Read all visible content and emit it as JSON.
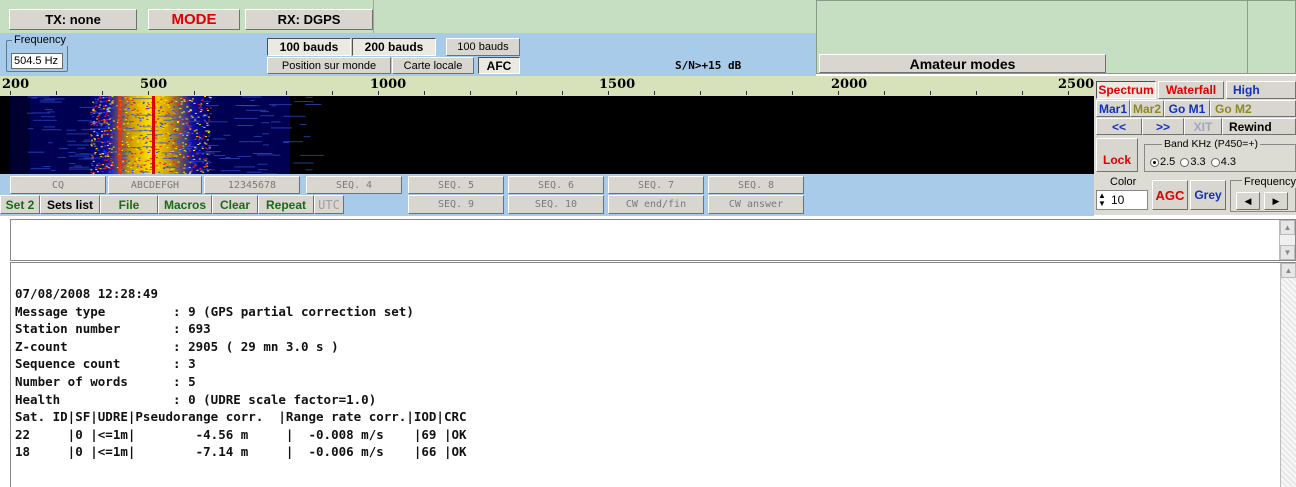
{
  "top_bar": {
    "tx_label": "TX: none",
    "mode_label": "MODE",
    "rx_label": "RX: DGPS"
  },
  "frequency": {
    "legend": "Frequency",
    "value": "504.5 Hz"
  },
  "baud_buttons": {
    "b100": "100 bauds",
    "b200": "200 bauds",
    "b100b": "100 bauds",
    "world_position": "Position sur monde",
    "local_map": "Carte locale",
    "afc": "AFC"
  },
  "snr_label": "S/N>+15  dB",
  "amateur_modes_label": "Amateur modes",
  "scale": {
    "labels": [
      "200",
      "500",
      "1000",
      "1500",
      "2000",
      "2500"
    ]
  },
  "right_controls": {
    "spectrum": "Spectrum",
    "waterfall": "Waterfall",
    "high": "High",
    "mar1": "Mar1",
    "mar2": "Mar2",
    "go_m1": "Go M1",
    "go_m2": "Go M2",
    "rewind_back": "<<",
    "forward": ">>",
    "xit": "XIT",
    "rewind": "Rewind",
    "lock": "Lock",
    "band_legend": "Band KHz (P450=+)",
    "band_opts": [
      "2.5",
      "3.3",
      "4.3"
    ],
    "color_label": "Color",
    "color_value": "10",
    "agc": "AGC",
    "grey": "Grey",
    "freq_label": "Frequency"
  },
  "macros_row1": [
    "CQ",
    "ABCDEFGH",
    "12345678",
    "SEQ. 4",
    "SEQ. 5",
    "SEQ. 6",
    "SEQ. 7",
    "SEQ. 8"
  ],
  "macros_row2": {
    "set2": "Set 2",
    "sets_list": "Sets list",
    "file": "File",
    "macros": "Macros",
    "clear": "Clear",
    "repeat": "Repeat",
    "utc": "UTC",
    "seq9": "SEQ. 9",
    "seq10": "SEQ. 10",
    "cw_end": "CW end/fin",
    "cw_answer": "CW answer"
  },
  "output_lines": [
    "07/08/2008 12:28:49",
    "Message type         : 9 (GPS partial correction set)",
    "Station number       : 693",
    "Z-count              : 2905 ( 29 mn 3.0 s )",
    "Sequence count       : 3",
    "Number of words      : 5",
    "Health               : 0 (UDRE scale factor=1.0)",
    "Sat. ID|SF|UDRE|Pseudorange corr.  |Range rate corr.|IOD|CRC",
    "22     |0 |<=1m|        -4.56 m     |  -0.008 m/s    |69 |OK",
    "18     |0 |<=1m|        -7.14 m     |  -0.006 m/s    |66 |OK"
  ],
  "colors": {
    "panel_green": "#c6dfc2",
    "panel_blue": "#a8cbea",
    "mode_red": "#e00000",
    "waterfall_bg": "#000000"
  }
}
